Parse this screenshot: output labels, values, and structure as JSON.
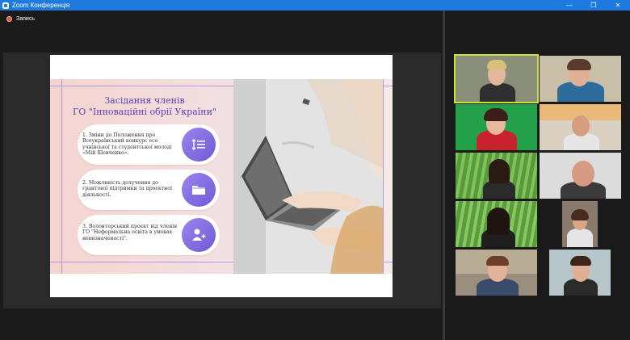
{
  "window": {
    "title": "Zoom Конференція",
    "buttons": [
      "—",
      "❐",
      "✕"
    ]
  },
  "recording": {
    "label": "Запись"
  },
  "slide": {
    "title_line1": "Засідання членів",
    "title_line2": "ГО \"Інноваційні обрії України\"",
    "items": [
      {
        "text": "1. Зміни до Положення про Всеукраїнський конкурс есе учнівської та студентської молоді «Мій Шевченко».",
        "icon": "list-icon"
      },
      {
        "text": "2. Можливість долучення до грантової підтримки та проєктної діяльності.",
        "icon": "folder-icon"
      },
      {
        "text": "3. Волонтерський проєкт від членів ГО \"Неформальна освіта в умовах невизначеності\".",
        "icon": "add-user-icon"
      }
    ]
  },
  "colors": {
    "titlebar": "#1f7ae0",
    "active_speaker_border": "#c9e33a",
    "slide_accent": "#5a3fae"
  }
}
